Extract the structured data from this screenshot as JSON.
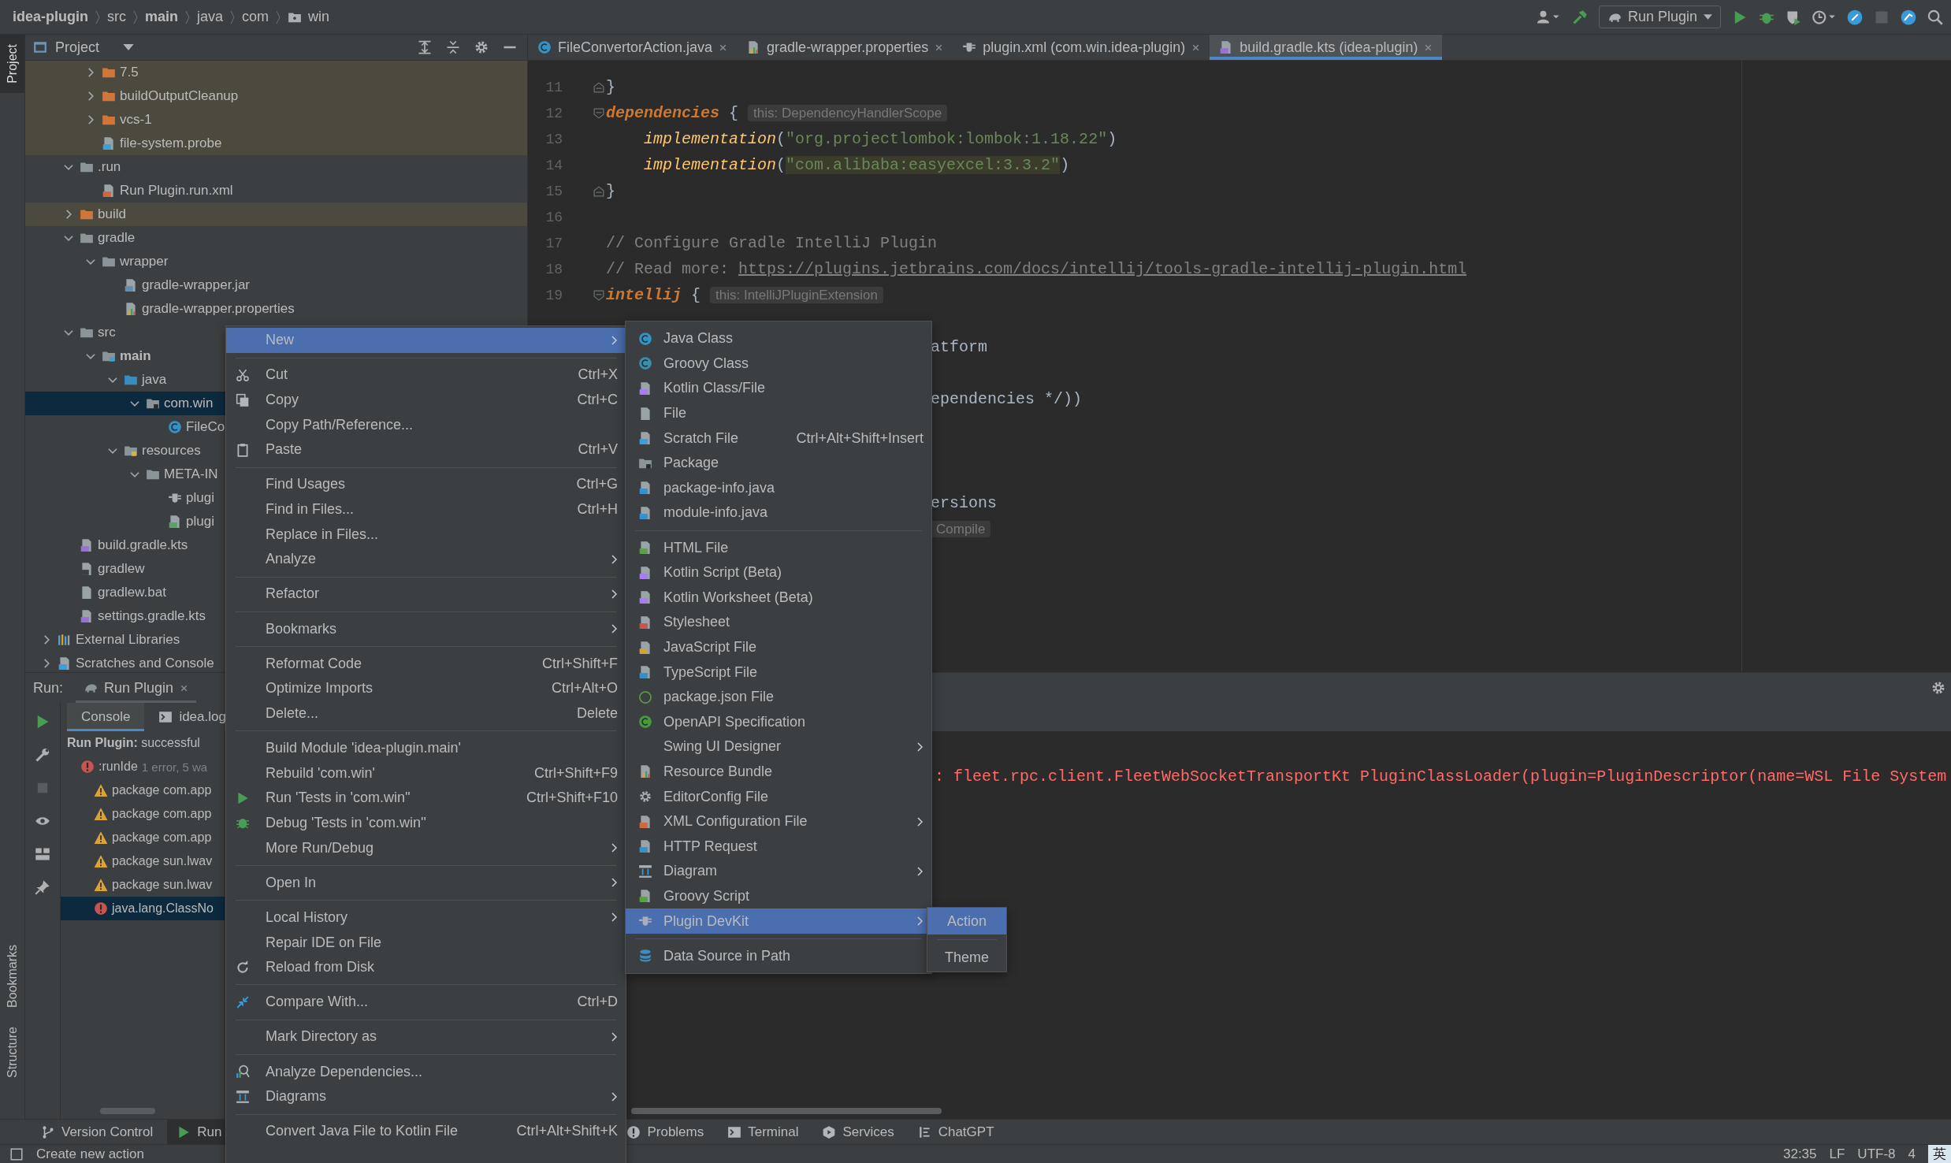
{
  "breadcrumb": [
    {
      "label": "idea-plugin",
      "bold": true,
      "folder": false
    },
    {
      "label": "src",
      "bold": false,
      "folder": false
    },
    {
      "label": "main",
      "bold": true,
      "folder": false
    },
    {
      "label": "java",
      "bold": false,
      "folder": false
    },
    {
      "label": "com",
      "bold": false,
      "folder": false
    },
    {
      "label": "win",
      "bold": false,
      "folder": true
    }
  ],
  "toolbar": {
    "run_config": "Run Plugin"
  },
  "left_stripe": [
    {
      "label": "Project",
      "selected": true
    },
    {
      "label": "Bookmarks",
      "selected": false
    },
    {
      "label": "Structure",
      "selected": false
    }
  ],
  "project": {
    "title": "Project",
    "tree": [
      {
        "children": [
          {
            "children": [
              {
                "label": "7.5",
                "kind": "folder-excluded",
                "expanded": false,
                "excluded": true,
                "selected": false
              },
              {
                "label": "buildOutputCleanup",
                "kind": "folder-excluded",
                "expanded": false,
                "excluded": true,
                "selected": false
              },
              {
                "label": "vcs-1",
                "kind": "folder-excluded",
                "expanded": false,
                "excluded": true,
                "selected": false
              },
              {
                "label": "file-system.probe",
                "kind": "probe",
                "excluded": true,
                "selected": false
              }
            ]
          },
          {
            "label": ".run",
            "kind": "folder",
            "expanded": true,
            "excluded": false,
            "selected": false,
            "children": [
              {
                "label": "Run Plugin.run.xml",
                "kind": "xml",
                "excluded": false,
                "selected": false
              }
            ]
          },
          {
            "label": "build",
            "kind": "folder-excluded",
            "expanded": false,
            "excluded": true,
            "selected": false
          },
          {
            "label": "gradle",
            "kind": "folder",
            "expanded": true,
            "excluded": false,
            "selected": false,
            "children": [
              {
                "label": "wrapper",
                "kind": "folder",
                "expanded": true,
                "excluded": false,
                "selected": false,
                "children": [
                  {
                    "label": "gradle-wrapper.jar",
                    "kind": "jar",
                    "excluded": false,
                    "selected": false
                  },
                  {
                    "label": "gradle-wrapper.properties",
                    "kind": "properties",
                    "excluded": false,
                    "selected": false
                  }
                ]
              }
            ]
          },
          {
            "label": "src",
            "kind": "folder",
            "expanded": true,
            "excluded": false,
            "selected": false,
            "children": [
              {
                "label": "main",
                "kind": "folder-module",
                "bold": true,
                "expanded": true,
                "excluded": false,
                "selected": false,
                "children": [
                  {
                    "label": "java",
                    "kind": "folder-java",
                    "expanded": true,
                    "excluded": false,
                    "selected": false,
                    "children": [
                      {
                        "label": "com.win",
                        "kind": "package",
                        "expanded": true,
                        "excluded": false,
                        "selected": true,
                        "children": [
                          {
                            "label": "FileCo",
                            "kind": "java-class",
                            "excluded": false,
                            "selected": false
                          }
                        ]
                      }
                    ]
                  },
                  {
                    "label": "resources",
                    "kind": "folder-resources",
                    "expanded": true,
                    "excluded": false,
                    "selected": false,
                    "children": [
                      {
                        "label": "META-IN",
                        "kind": "folder",
                        "expanded": true,
                        "excluded": false,
                        "selected": false,
                        "children": [
                          {
                            "label": "plugi",
                            "kind": "plugin",
                            "excluded": false,
                            "selected": false
                          },
                          {
                            "label": "plugi",
                            "kind": "image",
                            "excluded": false,
                            "selected": false
                          }
                        ]
                      }
                    ]
                  }
                ]
              }
            ]
          },
          {
            "label": "build.gradle.kts",
            "kind": "gradle",
            "excluded": false,
            "selected": false
          },
          {
            "label": "gradlew",
            "kind": "shell",
            "excluded": false,
            "selected": false
          },
          {
            "label": "gradlew.bat",
            "kind": "file",
            "excluded": false,
            "selected": false
          },
          {
            "label": "settings.gradle.kts",
            "kind": "gradle",
            "excluded": false,
            "selected": false
          }
        ]
      },
      {
        "label": "External Libraries",
        "kind": "libraries",
        "expanded": false,
        "excluded": false,
        "selected": false
      },
      {
        "label": "Scratches and Console",
        "kind": "scratches",
        "expanded": false,
        "excluded": false,
        "selected": false
      }
    ]
  },
  "editor": {
    "tabs": [
      {
        "label": "FileConvertorAction.java",
        "kind": "java-class",
        "selected": false
      },
      {
        "label": "gradle-wrapper.properties",
        "kind": "properties",
        "selected": false
      },
      {
        "label": "plugin.xml (com.win.idea-plugin)",
        "kind": "plugin",
        "selected": false
      },
      {
        "label": "build.gradle.kts (idea-plugin)",
        "kind": "gradle",
        "selected": true
      }
    ],
    "lines": [
      {
        "kind": "line",
        "number": "11",
        "fold_end": true,
        "segments": [
          {
            "kind": "plain",
            "text": "}"
          }
        ]
      },
      {
        "kind": "line",
        "number": "12",
        "fold_start": true,
        "segments": [
          {
            "kind": "keyword",
            "text": "dependencies"
          },
          {
            "kind": "plain",
            "text": " { "
          },
          {
            "kind": "hint",
            "text": "this: DependencyHandlerScope"
          }
        ]
      },
      {
        "kind": "line",
        "number": "13",
        "segments": [
          {
            "kind": "call",
            "text": "    implementation"
          },
          {
            "kind": "plain",
            "text": "("
          },
          {
            "kind": "string",
            "text": "\"org.projectlombok:lombok:1.18.22\""
          },
          {
            "kind": "plain",
            "text": ")"
          }
        ]
      },
      {
        "kind": "line",
        "number": "14",
        "segments": [
          {
            "kind": "call",
            "text": "    implementation"
          },
          {
            "kind": "plain",
            "text": "("
          },
          {
            "kind": "string-marked",
            "text": "\"com.alibaba:easyexcel:3.3.2\""
          },
          {
            "kind": "plain",
            "text": ")"
          }
        ]
      },
      {
        "kind": "line",
        "number": "15",
        "fold_end": true,
        "segments": [
          {
            "kind": "plain",
            "text": "}"
          }
        ]
      },
      {
        "kind": "line",
        "number": "16"
      },
      {
        "kind": "line",
        "number": "17",
        "segments": [
          {
            "kind": "comment",
            "text": "// Configure Gradle IntelliJ Plugin"
          }
        ]
      },
      {
        "kind": "line",
        "number": "18",
        "segments": [
          {
            "kind": "comment",
            "text": "// Read more: "
          },
          {
            "kind": "link",
            "text": "https://plugins.jetbrains.com/docs/intellij/tools-gradle-intellij-plugin.html"
          }
        ]
      },
      {
        "kind": "line",
        "number": "19",
        "fold_start": true,
        "segments": [
          {
            "kind": "keyword",
            "text": "intellij"
          },
          {
            "kind": "plain",
            "text": " { "
          },
          {
            "kind": "hint",
            "text": "this: IntelliJPluginExtension"
          }
        ]
      },
      {
        "kind": "blank"
      },
      {
        "kind": "fragment",
        "segments": [
          {
            "kind": "plain",
            "text": "atform"
          }
        ]
      },
      {
        "kind": "blank"
      },
      {
        "kind": "fragment",
        "segments": [
          {
            "kind": "plain",
            "text": "ependencies */))"
          }
        ]
      },
      {
        "kind": "blank"
      },
      {
        "kind": "blank"
      },
      {
        "kind": "blank"
      },
      {
        "kind": "fragment",
        "segments": [
          {
            "kind": "plain",
            "text": "ersions"
          }
        ]
      },
      {
        "kind": "fragment",
        "segments": [
          {
            "kind": "hint",
            "text": "Compile"
          }
        ]
      }
    ]
  },
  "run_panel": {
    "label": "Run:",
    "tab": "Run Plugin",
    "console_tabs": [
      {
        "label": "Console",
        "selected": true
      },
      {
        "label": "idea.log",
        "selected": false
      }
    ],
    "results": [
      {
        "text": "**Run Plugin:** successful",
        "selected": false,
        "children": [
          {
            "text": ":runIde",
            "detail": "1 error, 5 wa",
            "kind": "error",
            "selected": false,
            "children": [
              {
                "text": "package com.app",
                "kind": "warning",
                "selected": false
              },
              {
                "text": "package com.app",
                "kind": "warning",
                "selected": false
              },
              {
                "text": "package com.app",
                "kind": "warning",
                "selected": false
              },
              {
                "text": "package sun.lwav",
                "kind": "warning",
                "selected": false
              },
              {
                "text": "package sun.lwav",
                "kind": "warning",
                "selected": false
              },
              {
                "text": "java.lang.ClassNo",
                "kind": "error",
                "selected": true
              }
            ]
          }
        ]
      }
    ],
    "output": ": fleet.rpc.client.FleetWebSocketTransportKt PluginClassLoader(plugin=PluginDescriptor(name=WSL File System"
  },
  "context_menu": {
    "groups": [
      [
        {
          "label": "New",
          "submenu": true,
          "selected": true
        }
      ],
      [
        {
          "label": "Cut",
          "shortcut": "Ctrl+X",
          "kind": "cut",
          "submenu": false,
          "selected": false
        },
        {
          "label": "Copy",
          "shortcut": "Ctrl+C",
          "kind": "copy",
          "submenu": false,
          "selected": false
        },
        {
          "label": "Copy Path/Reference...",
          "submenu": false,
          "selected": false
        },
        {
          "label": "Paste",
          "shortcut": "Ctrl+V",
          "kind": "paste",
          "submenu": false,
          "selected": false
        }
      ],
      [
        {
          "label": "Find Usages",
          "shortcut": "Ctrl+G",
          "submenu": false,
          "selected": false
        },
        {
          "label": "Find in Files...",
          "shortcut": "Ctrl+H",
          "submenu": false,
          "selected": false
        },
        {
          "label": "Replace in Files...",
          "submenu": false,
          "selected": false
        },
        {
          "label": "Analyze",
          "submenu": true,
          "selected": false
        }
      ],
      [
        {
          "label": "Refactor",
          "submenu": true,
          "selected": false
        }
      ],
      [
        {
          "label": "Bookmarks",
          "submenu": true,
          "selected": false
        }
      ],
      [
        {
          "label": "Reformat Code",
          "shortcut": "Ctrl+Shift+F",
          "submenu": false,
          "selected": false
        },
        {
          "label": "Optimize Imports",
          "shortcut": "Ctrl+Alt+O",
          "submenu": false,
          "selected": false
        },
        {
          "label": "Delete...",
          "shortcut": "Delete",
          "submenu": false,
          "selected": false
        }
      ],
      [
        {
          "label": "Build Module 'idea-plugin.main'",
          "submenu": false,
          "selected": false
        },
        {
          "label": "Rebuild 'com.win'",
          "shortcut": "Ctrl+Shift+F9",
          "submenu": false,
          "selected": false
        },
        {
          "label": "Run 'Tests in 'com.win''",
          "shortcut": "Ctrl+Shift+F10",
          "kind": "run",
          "submenu": false,
          "selected": false
        },
        {
          "label": "Debug 'Tests in 'com.win''",
          "kind": "debug",
          "submenu": false,
          "selected": false
        },
        {
          "label": "More Run/Debug",
          "submenu": true,
          "selected": false
        }
      ],
      [
        {
          "label": "Open In",
          "submenu": true,
          "selected": false
        }
      ],
      [
        {
          "label": "Local History",
          "submenu": true,
          "selected": false
        },
        {
          "label": "Repair IDE on File",
          "submenu": false,
          "selected": false
        },
        {
          "label": "Reload from Disk",
          "kind": "reload",
          "submenu": false,
          "selected": false
        }
      ],
      [
        {
          "label": "Compare With...",
          "shortcut": "Ctrl+D",
          "kind": "compare",
          "submenu": false,
          "selected": false
        }
      ],
      [
        {
          "label": "Mark Directory as",
          "submenu": true,
          "selected": false
        }
      ],
      [
        {
          "label": "Analyze Dependencies...",
          "kind": "analyze",
          "submenu": false,
          "selected": false
        },
        {
          "label": "Diagrams",
          "kind": "diagram",
          "submenu": true,
          "selected": false
        }
      ],
      [
        {
          "label": "Convert Java File to Kotlin File",
          "shortcut": "Ctrl+Alt+Shift+K",
          "submenu": false,
          "selected": false
        }
      ]
    ]
  },
  "new_submenu": {
    "groups": [
      [
        {
          "label": "Java Class",
          "kind": "java-class",
          "submenu": false,
          "selected": false
        },
        {
          "label": "Groovy Class",
          "kind": "groovy-class",
          "submenu": false,
          "selected": false
        },
        {
          "label": "Kotlin Class/File",
          "kind": "kotlin",
          "submenu": false,
          "selected": false
        },
        {
          "label": "File",
          "kind": "file",
          "submenu": false,
          "selected": false
        },
        {
          "label": "Scratch File",
          "shortcut": "Ctrl+Alt+Shift+Insert",
          "kind": "scratch",
          "submenu": false,
          "selected": false
        },
        {
          "label": "Package",
          "kind": "package",
          "submenu": false,
          "selected": false
        },
        {
          "label": "package-info.java",
          "kind": "java-file",
          "submenu": false,
          "selected": false
        },
        {
          "label": "module-info.java",
          "kind": "java-file",
          "submenu": false,
          "selected": false
        }
      ],
      [
        {
          "label": "HTML File",
          "kind": "html",
          "submenu": false,
          "selected": false
        },
        {
          "label": "Kotlin Script (Beta)",
          "kind": "kotlin",
          "submenu": false,
          "selected": false
        },
        {
          "label": "Kotlin Worksheet (Beta)",
          "kind": "kotlin",
          "submenu": false,
          "selected": false
        },
        {
          "label": "Stylesheet",
          "kind": "css",
          "submenu": false,
          "selected": false
        },
        {
          "label": "JavaScript File",
          "kind": "js",
          "submenu": false,
          "selected": false
        },
        {
          "label": "TypeScript File",
          "kind": "ts",
          "submenu": false,
          "selected": false
        },
        {
          "label": "package.json File",
          "kind": "json",
          "submenu": false,
          "selected": false
        },
        {
          "label": "OpenAPI Specification",
          "kind": "openapi",
          "submenu": false,
          "selected": false
        },
        {
          "label": "Swing UI Designer",
          "submenu": true,
          "selected": false
        },
        {
          "label": "Resource Bundle",
          "kind": "properties",
          "submenu": false,
          "selected": false
        },
        {
          "label": "EditorConfig File",
          "kind": "gear",
          "submenu": false,
          "selected": false
        },
        {
          "label": "XML Configuration File",
          "kind": "xml",
          "submenu": true,
          "selected": false
        },
        {
          "label": "HTTP Request",
          "kind": "http",
          "submenu": false,
          "selected": false
        },
        {
          "label": "Diagram",
          "kind": "diagram",
          "submenu": true,
          "selected": false
        },
        {
          "label": "Groovy Script",
          "kind": "groovy-script",
          "submenu": false,
          "selected": false
        },
        {
          "label": "Plugin DevKit",
          "kind": "plugin",
          "submenu": true,
          "selected": true
        }
      ],
      [
        {
          "label": "Data Source in Path",
          "kind": "database",
          "submenu": false,
          "selected": false
        }
      ]
    ]
  },
  "devkit_submenu": {
    "items": [
      {
        "label": "Action",
        "selected": true
      },
      {
        "label": "Theme",
        "selected": false
      }
    ]
  },
  "tool_windows": {
    "left": [
      {
        "label": "Version Control",
        "kind": "vcs",
        "selected": false
      },
      {
        "label": "Run",
        "kind": "run",
        "selected": true
      }
    ],
    "right": [
      {
        "label": "Problems",
        "kind": "problems",
        "selected": false
      },
      {
        "label": "Terminal",
        "kind": "terminal",
        "selected": false
      },
      {
        "label": "Services",
        "kind": "services",
        "selected": false
      },
      {
        "label": "ChatGPT",
        "kind": "chat",
        "selected": false
      }
    ]
  },
  "status": {
    "message": "Create new action",
    "items": [
      "32:35",
      "LF",
      "UTF-8",
      "4"
    ],
    "ime": "英"
  }
}
